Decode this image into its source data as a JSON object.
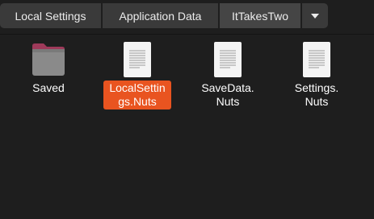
{
  "pathbar": {
    "segments": [
      {
        "label": "Local Settings"
      },
      {
        "label": "Application Data"
      },
      {
        "label": "ItTakesTwo"
      }
    ],
    "menu_icon": "caret-down-icon"
  },
  "files": [
    {
      "name": "Saved",
      "type": "folder",
      "icon": "folder-icon",
      "selected": false
    },
    {
      "name": "LocalSettings.Nuts",
      "display": [
        "LocalSettin",
        "gs.Nuts"
      ],
      "type": "file",
      "icon": "text-file-icon",
      "selected": true
    },
    {
      "name": "SaveData.Nuts",
      "display": [
        "SaveData.",
        "Nuts"
      ],
      "type": "file",
      "icon": "text-file-icon",
      "selected": false
    },
    {
      "name": "Settings.Nuts",
      "display": [
        "Settings.",
        "Nuts"
      ],
      "type": "file",
      "icon": "text-file-icon",
      "selected": false
    }
  ],
  "colors": {
    "background": "#1e1e1e",
    "selection": "#e95420",
    "folder": "#8a8a8a",
    "folder_tab": "#9e3a5a"
  }
}
